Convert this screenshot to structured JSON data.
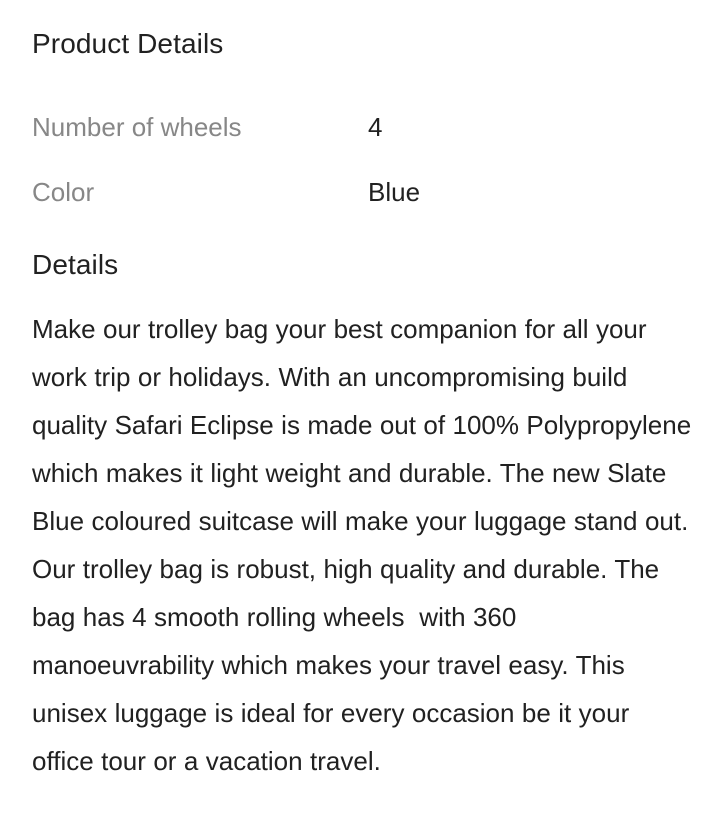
{
  "product_details": {
    "title": "Product Details",
    "specs": [
      {
        "label": "Number of wheels",
        "value": "4"
      },
      {
        "label": "Color",
        "value": "Blue"
      }
    ]
  },
  "details": {
    "title": "Details",
    "description": "Make our trolley bag your best companion for all your work trip or holidays. With an uncompromising build quality Safari Eclipse is made out of 100% Polypropylene which makes it light weight and durable. The new Slate Blue coloured suitcase will make your luggage stand out. Our trolley bag is robust, high quality and durable. The bag has 4 smooth rolling wheels  with 360 manoeuvrability which makes your travel easy. This unisex luggage is ideal for every occasion be it your office tour or a vacation travel."
  },
  "colors": {
    "text_primary": "#212121",
    "text_secondary": "#878787",
    "background": "#ffffff"
  }
}
